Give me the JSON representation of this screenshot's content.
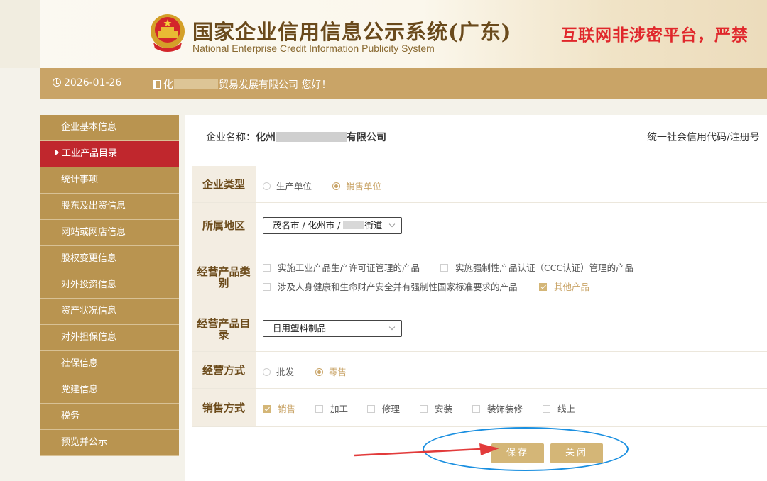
{
  "header": {
    "site_title": "国家企业信用信息公示系统(广东)",
    "site_subtitle": "National Enterprise Credit Information Publicity System",
    "notice": "互联网非涉密平台，严禁"
  },
  "infobar": {
    "date": "2026-01-26",
    "greeting_prefix": "化",
    "greeting_suffix": "贸易发展有限公司 您好！"
  },
  "sidebar": {
    "items": [
      {
        "label": "企业基本信息"
      },
      {
        "label": "工业产品目录",
        "active": true
      },
      {
        "label": "统计事项"
      },
      {
        "label": "股东及出资信息"
      },
      {
        "label": "网站或网店信息"
      },
      {
        "label": "股权变更信息"
      },
      {
        "label": "对外投资信息"
      },
      {
        "label": "资产状况信息"
      },
      {
        "label": "对外担保信息"
      },
      {
        "label": "社保信息"
      },
      {
        "label": "党建信息"
      },
      {
        "label": "税务"
      },
      {
        "label": "预览并公示"
      }
    ]
  },
  "company": {
    "name_label": "企业名称：",
    "name_prefix": "化州",
    "name_suffix": "有限公司",
    "code_label": "统一社会信用代码/注册号"
  },
  "form": {
    "enterprise_type": {
      "label": "企业类型",
      "options": [
        "生产单位",
        "销售单位"
      ],
      "selected": "销售单位"
    },
    "region": {
      "label": "所属地区",
      "value_prefix": "茂名市 / 化州市 /",
      "value_suffix": "街道"
    },
    "product_category": {
      "label": "经营产品类别",
      "options": [
        {
          "text": "实施工业产品生产许可证管理的产品",
          "checked": false
        },
        {
          "text": "实施强制性产品认证（CCC认证）管理的产品",
          "checked": false
        },
        {
          "text": "涉及人身健康和生命财产安全并有强制性国家标准要求的产品",
          "checked": false
        },
        {
          "text": "其他产品",
          "checked": true
        }
      ]
    },
    "product_catalog": {
      "label": "经营产品目录",
      "value": "日用塑料制品"
    },
    "business_mode": {
      "label": "经营方式",
      "options": [
        "批发",
        "零售"
      ],
      "selected": "零售"
    },
    "sales_mode": {
      "label": "销售方式",
      "options": [
        {
          "text": "销售",
          "checked": true
        },
        {
          "text": "加工",
          "checked": false
        },
        {
          "text": "修理",
          "checked": false
        },
        {
          "text": "安装",
          "checked": false
        },
        {
          "text": "装饰装修",
          "checked": false
        },
        {
          "text": "线上",
          "checked": false
        }
      ]
    }
  },
  "actions": {
    "save": "保存",
    "close": "关闭"
  },
  "colors": {
    "gold": "#c9a467",
    "sidebar": "#b99450",
    "active": "#c0272d",
    "notice": "#e0272b",
    "annotation_blue": "#1a8fe0",
    "annotation_arrow": "#e23b3b"
  }
}
